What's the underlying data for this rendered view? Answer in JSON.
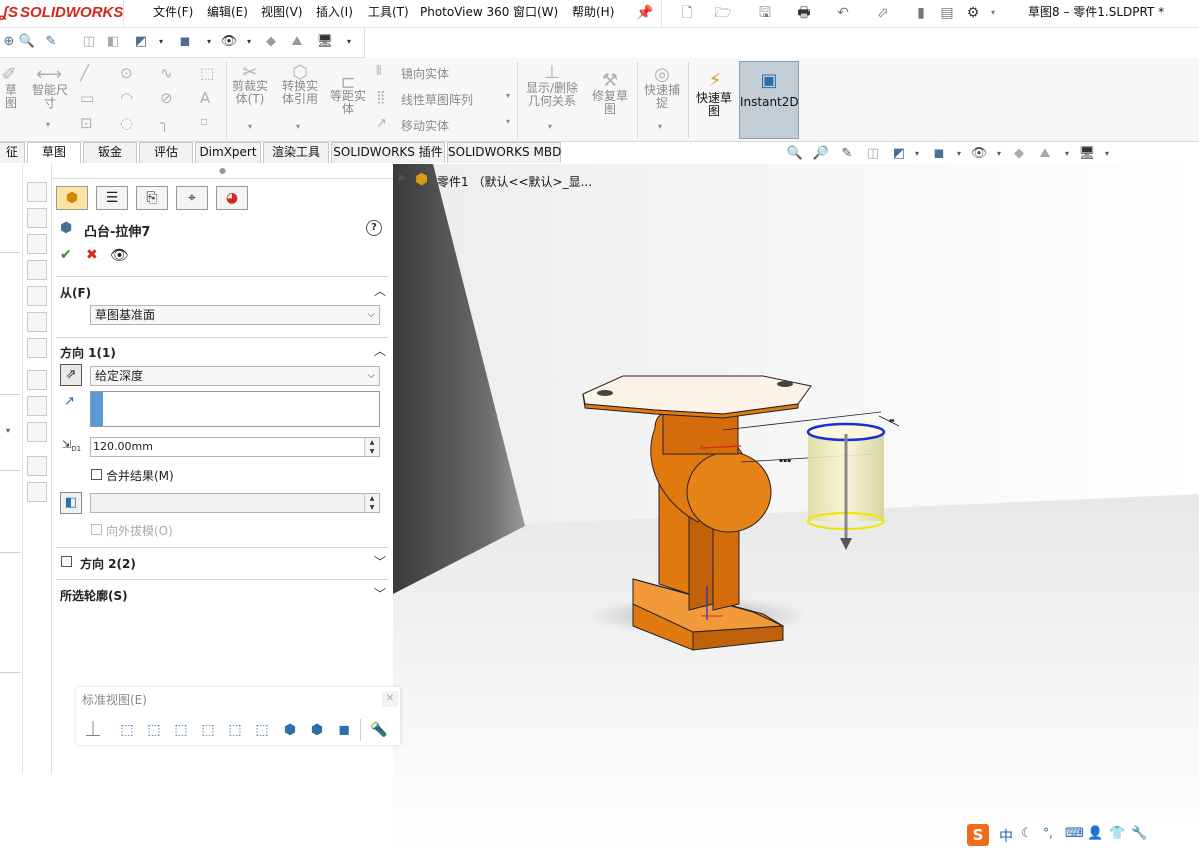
{
  "app": {
    "logo_text": "SOLIDWORKS",
    "document_title": "草图8 – 零件1.SLDPRT *"
  },
  "menu": [
    "文件(F)",
    "编辑(E)",
    "视图(V)",
    "插入(I)",
    "工具(T)",
    "PhotoView 360",
    "窗口(W)",
    "帮助(H)"
  ],
  "ribbon": {
    "sketch_btn": "草\n图",
    "smart_dim": "智能尺\n寸",
    "trim": "剪裁实\n体(T)",
    "convert": "转换实\n体引用",
    "offset": "等距实\n体",
    "mirror": "镜向实体",
    "linear_pattern": "线性草图阵列",
    "move": "移动实体",
    "show_relations": "显示/删除\n几何关系",
    "repair": "修复草\n图",
    "quick_snap": "快速捕\n捉",
    "rapid_sketch": "快速草\n图",
    "instant2d": "Instant2D"
  },
  "tabs": [
    "征",
    "草图",
    "钣金",
    "评估",
    "DimXpert",
    "渲染工具",
    "SOLIDWORKS 插件",
    "SOLIDWORKS MBD"
  ],
  "tree": {
    "root": "零件1 （默认<<默认>_显..."
  },
  "pm": {
    "title": "凸台-拉伸7",
    "help": "?",
    "from_label": "从(F)",
    "from_value": "草图基准面",
    "dir1_label": "方向 1(1)",
    "end_condition": "给定深度",
    "depth": "120.00mm",
    "depth_icon_label": "D1",
    "merge_label": "合并结果(M)",
    "draft_label": "向外拔模(O)",
    "dir2_label": "方向 2(2)",
    "contours_label": "所选轮廓(S)"
  },
  "standard_views": {
    "title": "标准视图(E)"
  },
  "colors": {
    "part": "#e07a10",
    "part_dark": "#c0600a",
    "preview": "#f4f1c3",
    "accent_red": "#d6261e"
  },
  "ime": {
    "label": "中"
  }
}
